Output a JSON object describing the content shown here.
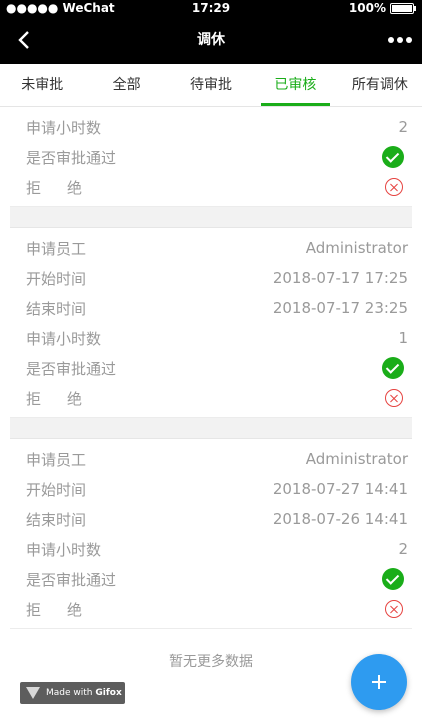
{
  "status_bar": {
    "carrier": "●●●●● WeChat",
    "time": "17:29",
    "battery": "100%"
  },
  "nav": {
    "title": "调休",
    "back_icon": "chevron-left-icon",
    "more_icon": "more-dots-icon"
  },
  "tabs": [
    {
      "label": "未审批"
    },
    {
      "label": "全部"
    },
    {
      "label": "待审批"
    },
    {
      "label": "已审核"
    },
    {
      "label": "所有调休"
    }
  ],
  "active_tab": "已审核",
  "colors": {
    "accent": "#1aad19",
    "reject": "#e64340",
    "fab": "#2e9bf0"
  },
  "records": [
    {
      "hours_label": "申请小时数",
      "hours": "2",
      "approved_label": "是否审批通过",
      "reject_label": "拒绝"
    },
    {
      "employee_label": "申请员工",
      "employee": "Administrator",
      "start_label": "开始时间",
      "start": "2018-07-17 17:25",
      "end_label": "结束时间",
      "end": "2018-07-17 23:25",
      "hours_label": "申请小时数",
      "hours": "1",
      "approved_label": "是否审批通过",
      "reject_label": "拒绝"
    },
    {
      "employee_label": "申请员工",
      "employee": "Administrator",
      "start_label": "开始时间",
      "start": "2018-07-27 14:41",
      "end_label": "结束时间",
      "end": "2018-07-26 14:41",
      "hours_label": "申请小时数",
      "hours": "2",
      "approved_label": "是否审批通过",
      "reject_label": "拒绝"
    }
  ],
  "footer": {
    "no_more": "暂无更多数据"
  },
  "watermark": {
    "text": "Made with",
    "brand": "Gifox"
  }
}
